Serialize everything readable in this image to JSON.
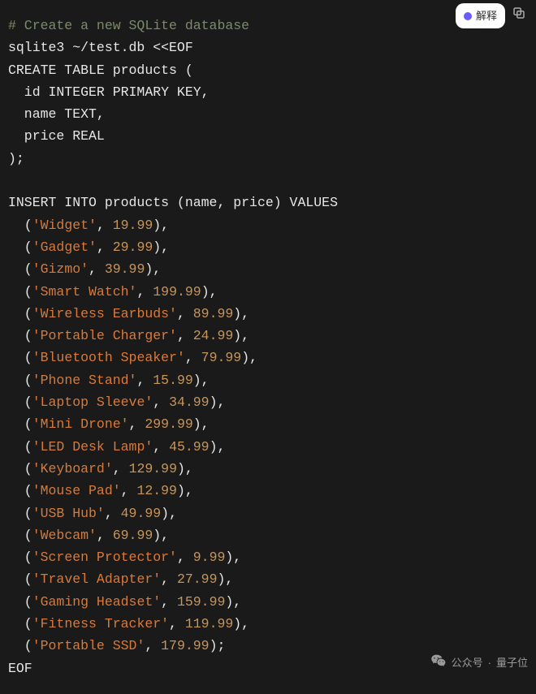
{
  "toolbar": {
    "explain_label": "解释",
    "copy_label": "Copy"
  },
  "code": {
    "comment": "# Create a new SQLite database",
    "cmd": "sqlite3 ~/test.db <<EOF",
    "create_table": [
      "CREATE TABLE products (",
      "  id INTEGER PRIMARY KEY,",
      "  name TEXT,",
      "  price REAL",
      ");"
    ],
    "insert_header": "INSERT INTO products (name, price) VALUES",
    "rows": [
      {
        "name": "Widget",
        "price": 19.99
      },
      {
        "name": "Gadget",
        "price": 29.99
      },
      {
        "name": "Gizmo",
        "price": 39.99
      },
      {
        "name": "Smart Watch",
        "price": 199.99
      },
      {
        "name": "Wireless Earbuds",
        "price": 89.99
      },
      {
        "name": "Portable Charger",
        "price": 24.99
      },
      {
        "name": "Bluetooth Speaker",
        "price": 79.99
      },
      {
        "name": "Phone Stand",
        "price": 15.99
      },
      {
        "name": "Laptop Sleeve",
        "price": 34.99
      },
      {
        "name": "Mini Drone",
        "price": 299.99
      },
      {
        "name": "LED Desk Lamp",
        "price": 45.99
      },
      {
        "name": "Keyboard",
        "price": 129.99
      },
      {
        "name": "Mouse Pad",
        "price": 12.99
      },
      {
        "name": "USB Hub",
        "price": 49.99
      },
      {
        "name": "Webcam",
        "price": 69.99
      },
      {
        "name": "Screen Protector",
        "price": 9.99
      },
      {
        "name": "Travel Adapter",
        "price": 27.99
      },
      {
        "name": "Gaming Headset",
        "price": 159.99
      },
      {
        "name": "Fitness Tracker",
        "price": 119.99
      },
      {
        "name": "Portable SSD",
        "price": 179.99
      }
    ],
    "eof": "EOF"
  },
  "watermark": {
    "label": "公众号",
    "dot": "·",
    "name": "量子位"
  }
}
